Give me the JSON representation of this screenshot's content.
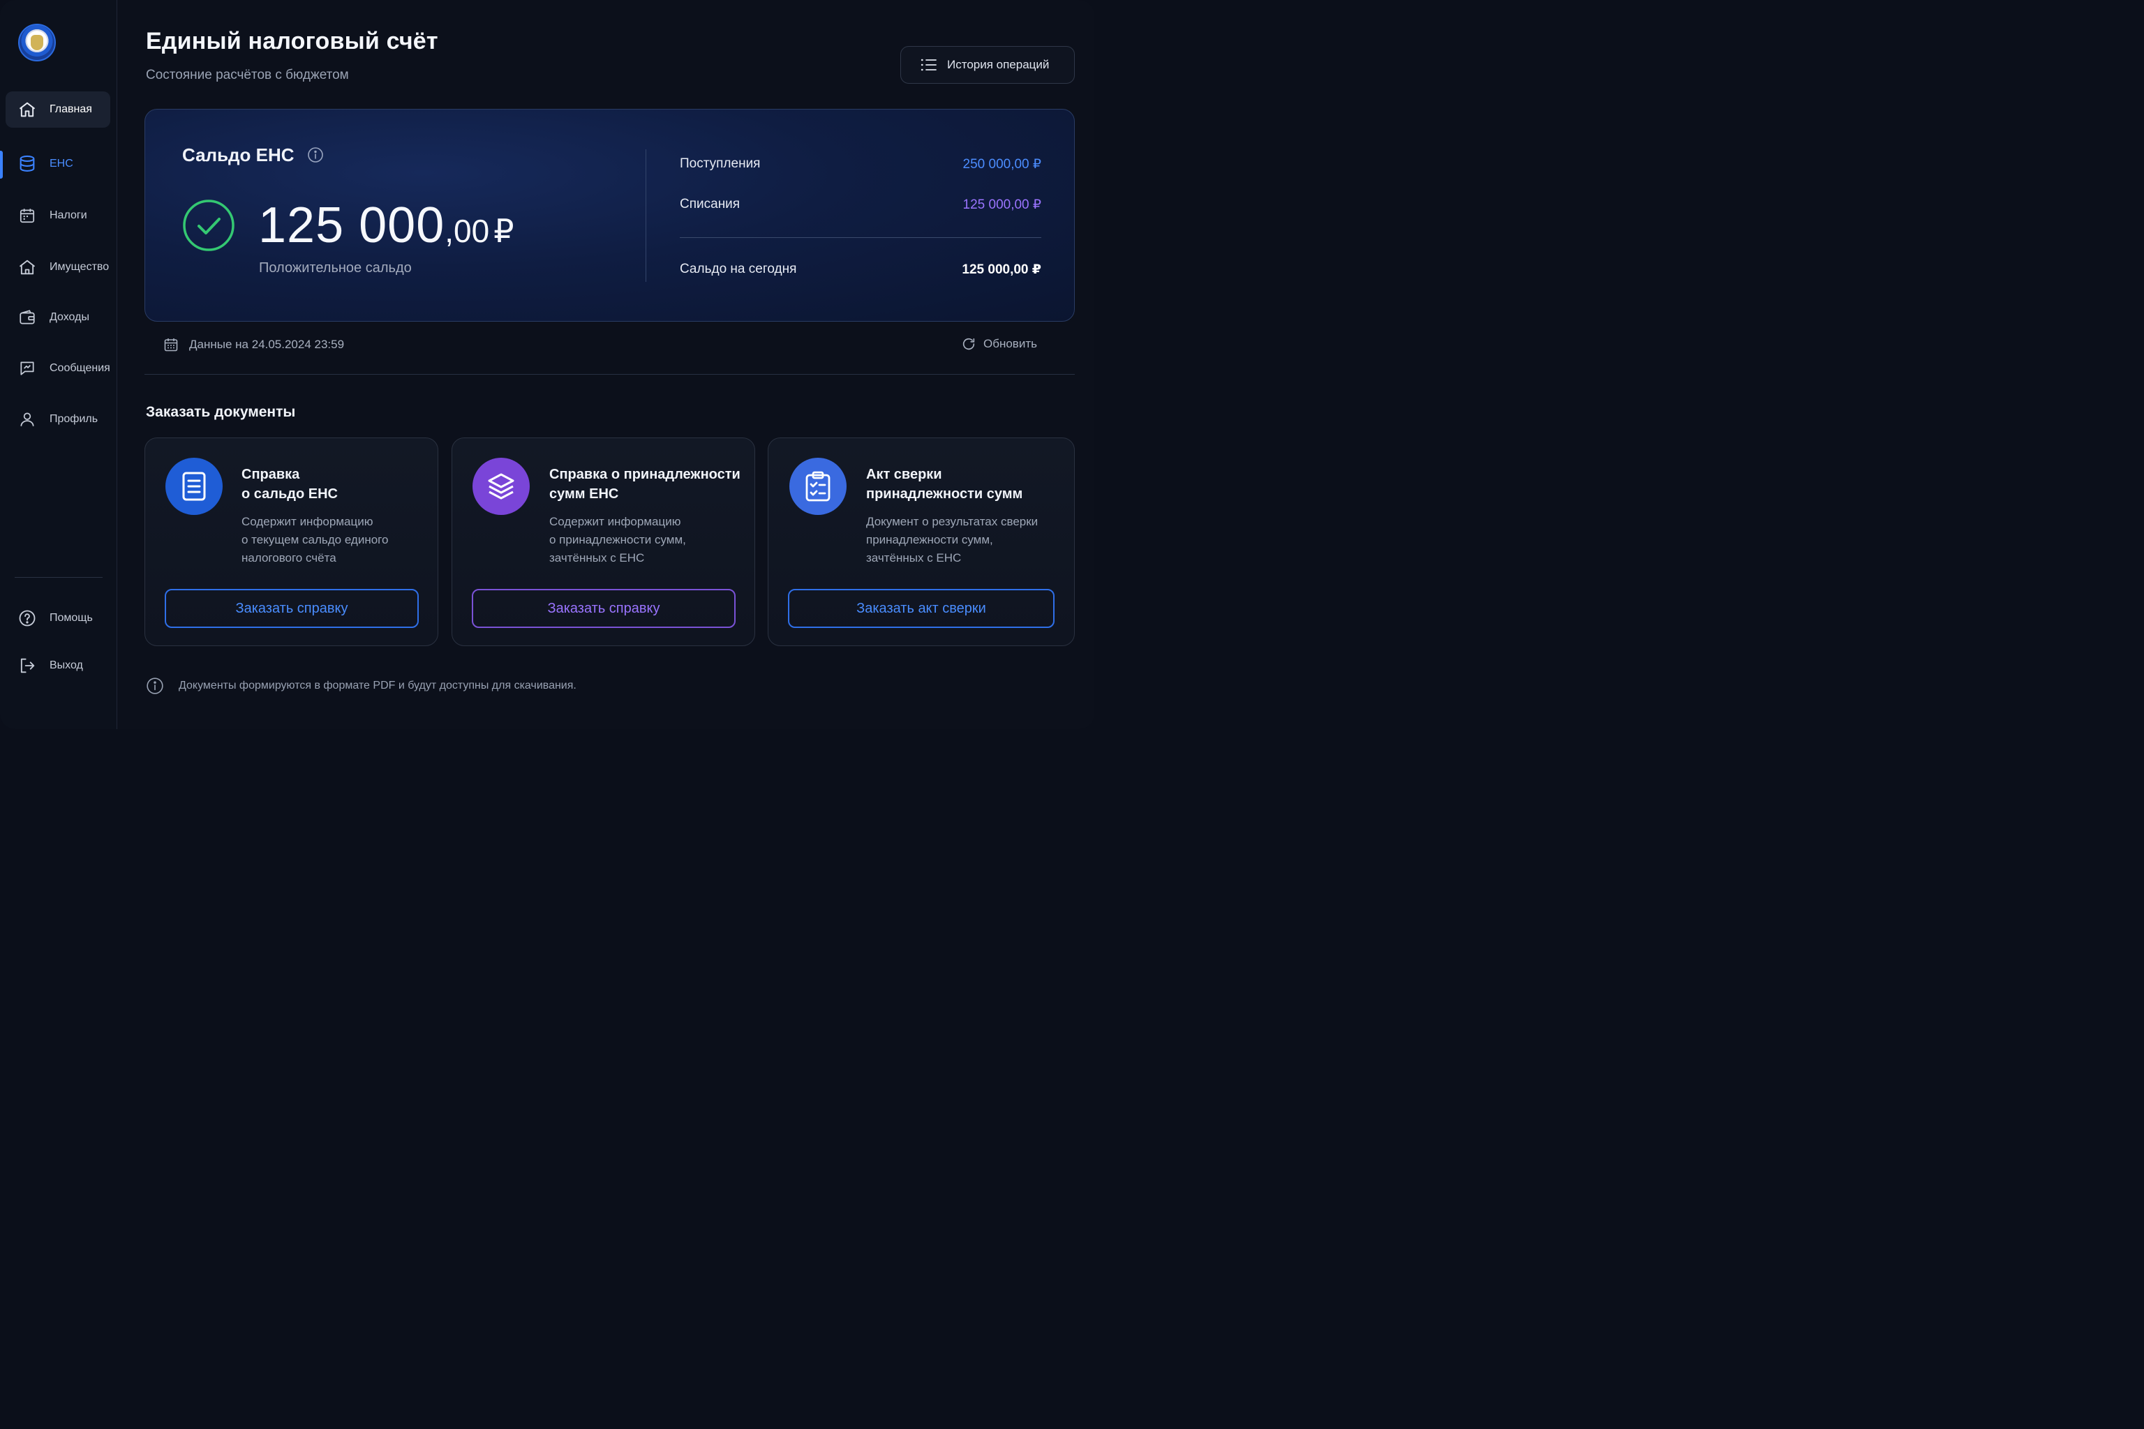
{
  "colors": {
    "accent_blue": "#3b82ff",
    "accent_purple": "#9a74ff",
    "positive_green": "#34c872",
    "background": "#0c101b"
  },
  "sidebar": {
    "items": [
      {
        "label": "Главная",
        "icon": "home-icon"
      },
      {
        "label": "ЕНС",
        "icon": "database-icon"
      },
      {
        "label": "Налоги",
        "icon": "calendar-icon"
      },
      {
        "label": "Имущество",
        "icon": "house-icon"
      },
      {
        "label": "Доходы",
        "icon": "wallet-icon"
      },
      {
        "label": "Сообщения",
        "icon": "message-icon"
      },
      {
        "label": "Профиль",
        "icon": "user-icon"
      }
    ],
    "bottom": [
      {
        "label": "Помощь",
        "icon": "help-icon"
      },
      {
        "label": "Выход",
        "icon": "logout-icon"
      }
    ]
  },
  "header": {
    "title": "Единый налоговый счёт",
    "subtitle": "Состояние расчётов с бюджетом",
    "history_button": "История операций"
  },
  "balance": {
    "label": "Сальдо ЕНС",
    "amount_int": "125 000",
    "amount_dec": ",00",
    "currency": "₽",
    "status": "Положительное сальдо",
    "stats": [
      {
        "label": "Поступления",
        "value": "250 000,00 ₽"
      },
      {
        "label": "Списания",
        "value": "125 000,00 ₽"
      },
      {
        "label": "Сальдо на сегодня",
        "value": "125 000,00 ₽"
      }
    ]
  },
  "meta": {
    "data_as_of": "Данные на 24.05.2024 23:59",
    "refresh": "Обновить"
  },
  "documents": {
    "section_title": "Заказать документы",
    "cards": [
      {
        "title_line1": "Справка",
        "title_line2": "о сальдо ЕНС",
        "desc_line1": "Содержит информацию",
        "desc_line2": "о текущем сальдо единого",
        "desc_line3": "налогового счёта",
        "button": "Заказать справку",
        "icon": "document-icon"
      },
      {
        "title_line1": "Справка о принадлежности",
        "title_line2": "сумм ЕНС",
        "desc_line1": "Содержит информацию",
        "desc_line2": "о принадлежности сумм,",
        "desc_line3": "зачтённых с ЕНС",
        "button": "Заказать справку",
        "icon": "layers-icon"
      },
      {
        "title_line1": "Акт сверки",
        "title_line2": "принадлежности сумм",
        "desc_line1": "Документ о результатах сверки",
        "desc_line2": "принадлежности сумм,",
        "desc_line3": "зачтённых с ЕНС",
        "button": "Заказать акт сверки",
        "icon": "clipboard-check-icon"
      }
    ],
    "footer_note": "Документы формируются в формате PDF и будут доступны для скачивания."
  }
}
